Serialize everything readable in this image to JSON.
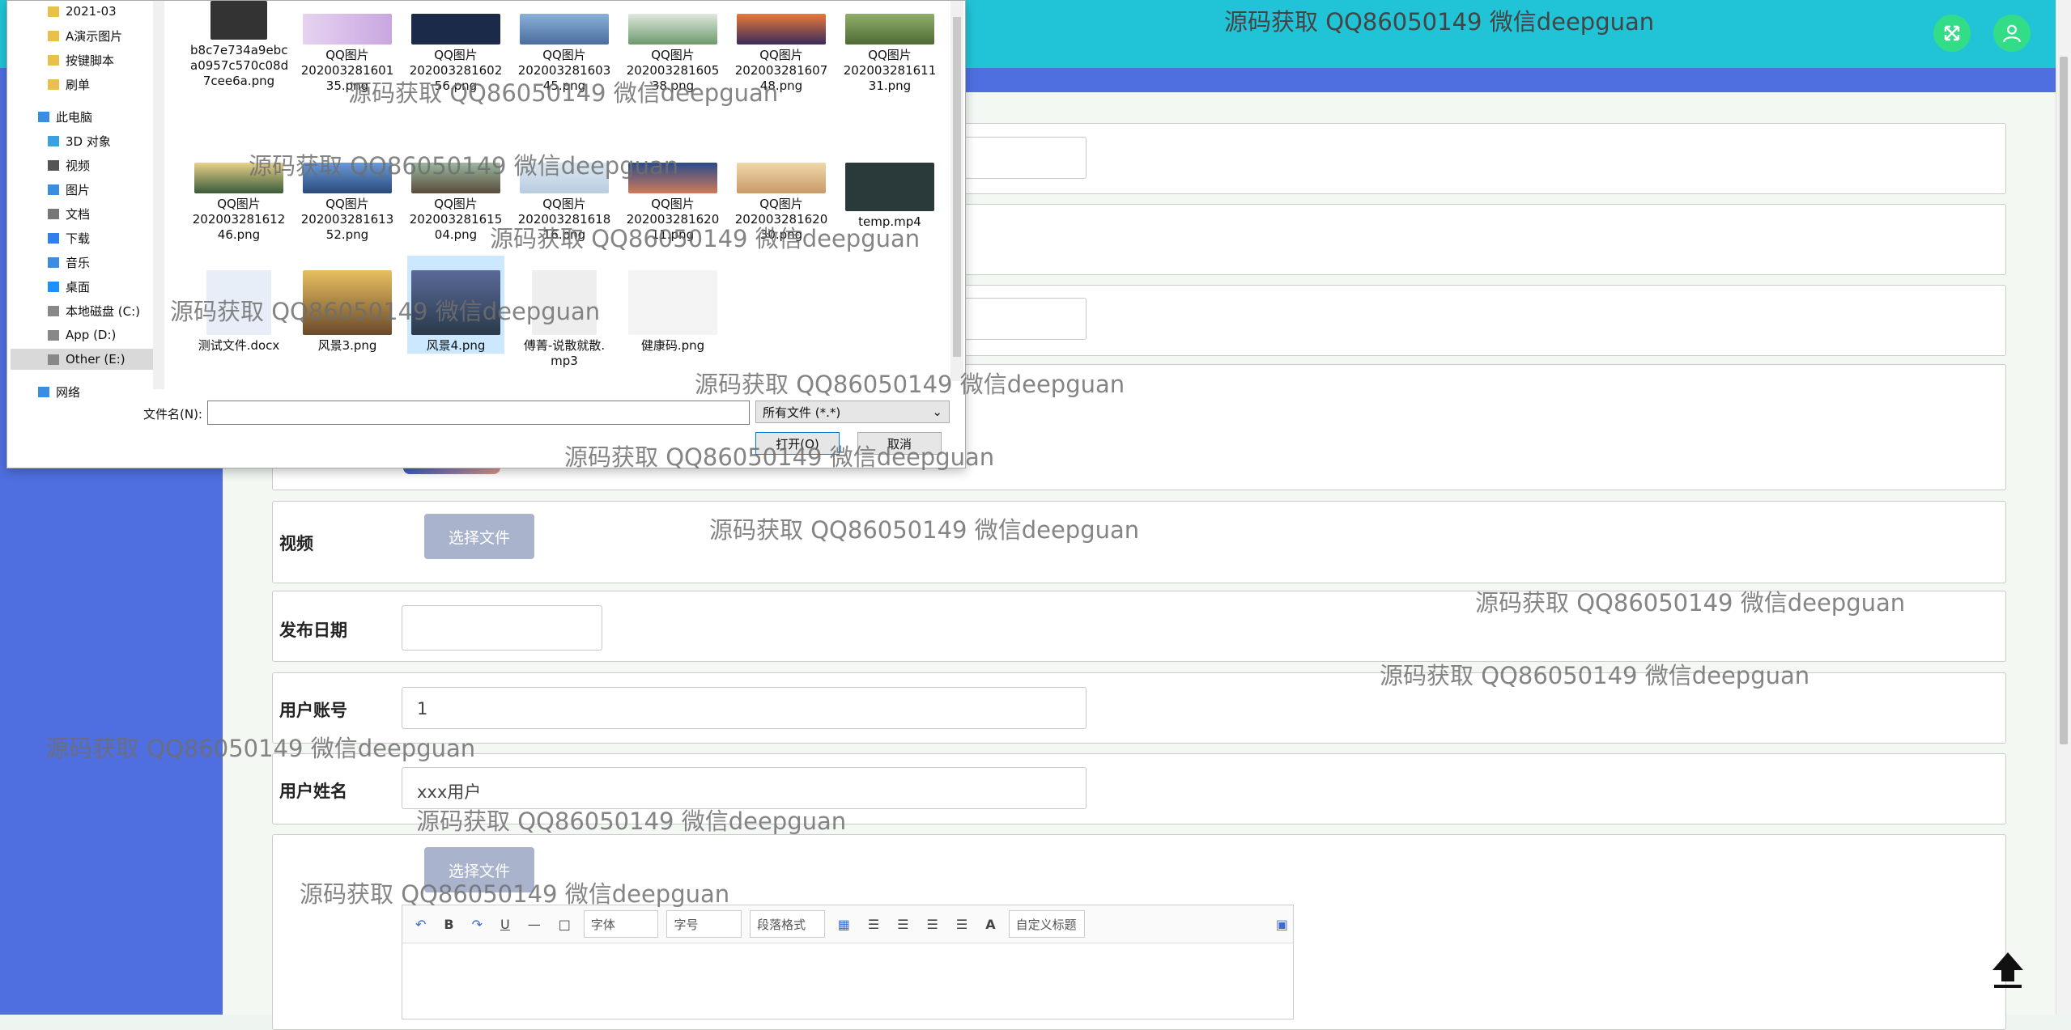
{
  "header": {
    "watermark_title": "源码获取 QQ86050149 微信deepguan"
  },
  "form": {
    "video_label": "视频",
    "video_button": "选择文件",
    "date_label": "发布日期",
    "date_value": "",
    "account_label": "用户账号",
    "account_value": "1",
    "name_label": "用户姓名",
    "name_value": "xxx用户",
    "upload_button": "选择文件"
  },
  "editor": {
    "font_select": "字体",
    "size_select": "字号",
    "paragraph_select": "段落格式",
    "custom_select": "自定义标题",
    "color_btn": "A"
  },
  "dialog": {
    "tree": [
      {
        "label": "2021-03",
        "icon": "folder-icon"
      },
      {
        "label": "A演示图片",
        "icon": "folder-icon"
      },
      {
        "label": "按键脚本",
        "icon": "folder-icon"
      },
      {
        "label": "刷单",
        "icon": "folder-icon"
      },
      {
        "label": "此电脑",
        "icon": "computer-icon"
      },
      {
        "label": "3D 对象",
        "icon": "cube-icon"
      },
      {
        "label": "视频",
        "icon": "video-icon"
      },
      {
        "label": "图片",
        "icon": "picture-icon"
      },
      {
        "label": "文档",
        "icon": "document-icon"
      },
      {
        "label": "下载",
        "icon": "download-icon"
      },
      {
        "label": "音乐",
        "icon": "music-icon"
      },
      {
        "label": "桌面",
        "icon": "desktop-icon"
      },
      {
        "label": "本地磁盘 (C:)",
        "icon": "drive-icon"
      },
      {
        "label": "App (D:)",
        "icon": "drive-icon"
      },
      {
        "label": "Other (E:)",
        "icon": "drive-icon"
      },
      {
        "label": "网络",
        "icon": "network-icon"
      }
    ],
    "files": [
      {
        "l1": "b8c7e734a9ebc",
        "l2": "a0957c570c08d",
        "l3": "7cee6a.png"
      },
      {
        "l1": "QQ图片",
        "l2": "202003281601",
        "l3": "35.png"
      },
      {
        "l1": "QQ图片",
        "l2": "202003281602",
        "l3": "56.png"
      },
      {
        "l1": "QQ图片",
        "l2": "202003281603",
        "l3": "45.png"
      },
      {
        "l1": "QQ图片",
        "l2": "202003281605",
        "l3": "38.png"
      },
      {
        "l1": "QQ图片",
        "l2": "202003281607",
        "l3": "48.png"
      },
      {
        "l1": "QQ图片",
        "l2": "202003281611",
        "l3": "31.png"
      },
      {
        "l1": "QQ图片",
        "l2": "202003281612",
        "l3": "46.png"
      },
      {
        "l1": "QQ图片",
        "l2": "202003281613",
        "l3": "52.png"
      },
      {
        "l1": "QQ图片",
        "l2": "202003281615",
        "l3": "04.png"
      },
      {
        "l1": "QQ图片",
        "l2": "202003281618",
        "l3": "16.png"
      },
      {
        "l1": "QQ图片",
        "l2": "202003281620",
        "l3": "11.png"
      },
      {
        "l1": "QQ图片",
        "l2": "202003281620",
        "l3": "30.png"
      },
      {
        "l1": "temp.mp4",
        "l2": "",
        "l3": ""
      },
      {
        "l1": "测试文件.docx",
        "l2": "",
        "l3": ""
      },
      {
        "l1": "风景3.png",
        "l2": "",
        "l3": ""
      },
      {
        "l1": "风景4.png",
        "l2": "",
        "l3": ""
      },
      {
        "l1": "傅菁-说散就散.",
        "l2": "mp3",
        "l3": ""
      },
      {
        "l1": "健康码.png",
        "l2": "",
        "l3": ""
      }
    ],
    "filename_label": "文件名(N):",
    "filename_value": "",
    "filetype_value": "所有文件 (*.*)",
    "open_button": "打开(O)",
    "cancel_button": "取消"
  },
  "watermark": "源码获取 QQ86050149 微信deepguan",
  "colors": {
    "header": "#21c4d6",
    "sidebar": "#4f6fe0",
    "green_button": "#33dd88"
  }
}
